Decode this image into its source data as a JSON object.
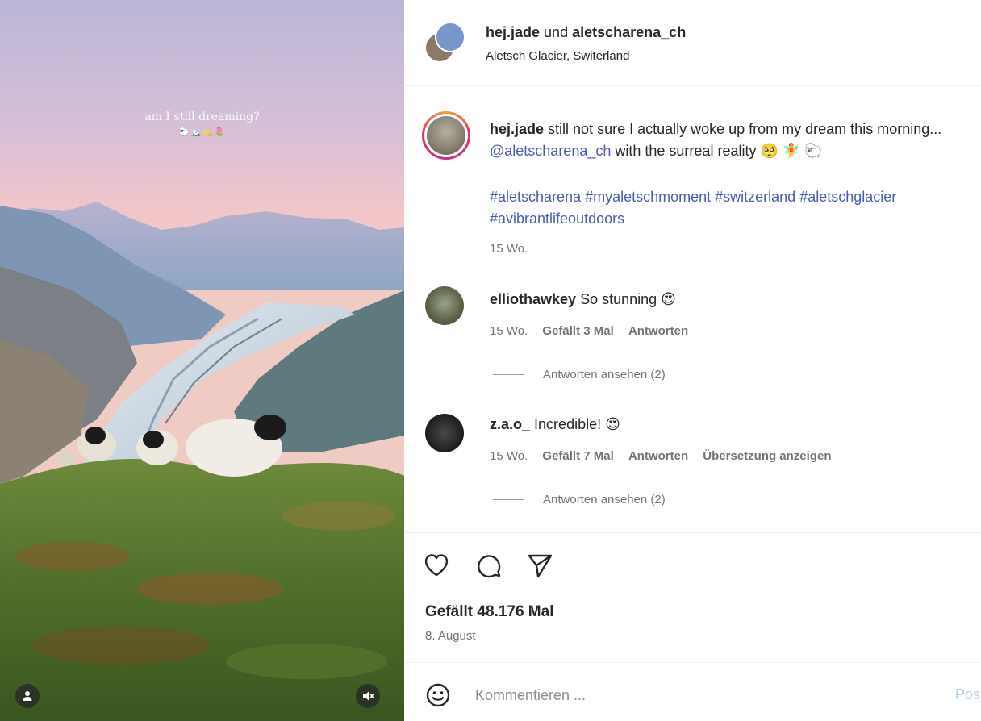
{
  "media": {
    "overlay_line1": "am I still dreaming?",
    "overlay_line2": "🐑🏔️💫🌷"
  },
  "header": {
    "user1": "hej.jade",
    "connector": "und",
    "user2": "aletscharena_ch",
    "location": "Aletsch Glacier, Switerland"
  },
  "caption": {
    "username": "hej.jade",
    "text_before": "still not sure I actually woke up from my dream this morning...",
    "mention": "@aletscharena_ch",
    "text_after": "with the surreal reality 🥺 🧚 🐑",
    "hashtags": "#aletscharena #myaletschmoment #switzerland #aletschglacier #avibrantlifeoutdoors",
    "time": "15 Wo."
  },
  "comments": [
    {
      "username": "elliothawkey",
      "text": "So stunning 😍",
      "time": "15 Wo.",
      "likes": "Gefällt 3 Mal",
      "reply": "Antworten",
      "view_replies": "Antworten ansehen (2)"
    },
    {
      "username": "z.a.o_",
      "text": "Incredible! 😍",
      "time": "15 Wo.",
      "likes": "Gefällt 7 Mal",
      "reply": "Antworten",
      "translate": "Übersetzung anzeigen",
      "view_replies": "Antworten ansehen (2)"
    }
  ],
  "actions": {
    "like_icon": "heart-icon",
    "comment_icon": "comment-bubble-icon",
    "share_icon": "paper-plane-icon"
  },
  "likes_count": "Gefällt 48.176 Mal",
  "post_date": "8. August",
  "composer": {
    "placeholder": "Kommentieren ...",
    "post_label": "Pos"
  },
  "colors": {
    "link": "#4a5bb8",
    "muted": "#737373",
    "post_disabled": "#b3cdf5"
  }
}
